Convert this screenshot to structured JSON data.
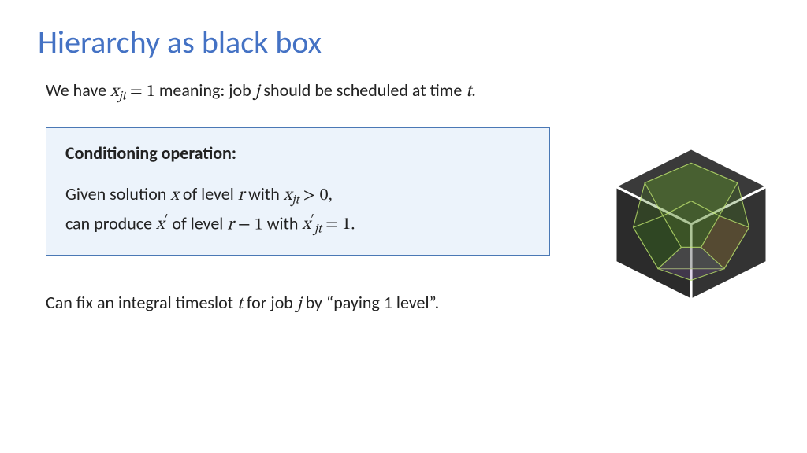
{
  "title": "Hierarchy as black box",
  "line1_a": "We have ",
  "line1_b": " meaning: job ",
  "line1_c": " should be scheduled at time ",
  "line1_d": ".",
  "box_title": "Conditioning operation:",
  "box_l1_a": "Given solution ",
  "box_l1_b": " of level ",
  "box_l1_c": " with ",
  "box_l1_d": ",",
  "box_l2_a": "can produce ",
  "box_l2_b": " of level ",
  "box_l2_c": " with ",
  "box_l2_d": ".",
  "footer_a": "Can fix an integral timeslot ",
  "footer_b": " for job ",
  "footer_c": " by “paying 1 level”.",
  "m_xjt_eq1_var": "x",
  "m_xjt_eq1_sub": "jt",
  "m_xjt_eq1_rhs": " = 1",
  "m_j": "j",
  "m_t": "t",
  "m_x": "x",
  "m_r": "r",
  "m_xjt_gt0_sub": "jt",
  "m_xjt_gt0_rhs": " > 0",
  "m_xprime": "x",
  "m_prime": "′",
  "m_rminus1_lhs": "r",
  "m_rminus1_rhs": " − 1",
  "m_xprime_jt_sub": "jt",
  "m_xprime_jt_rhs": " = 1"
}
